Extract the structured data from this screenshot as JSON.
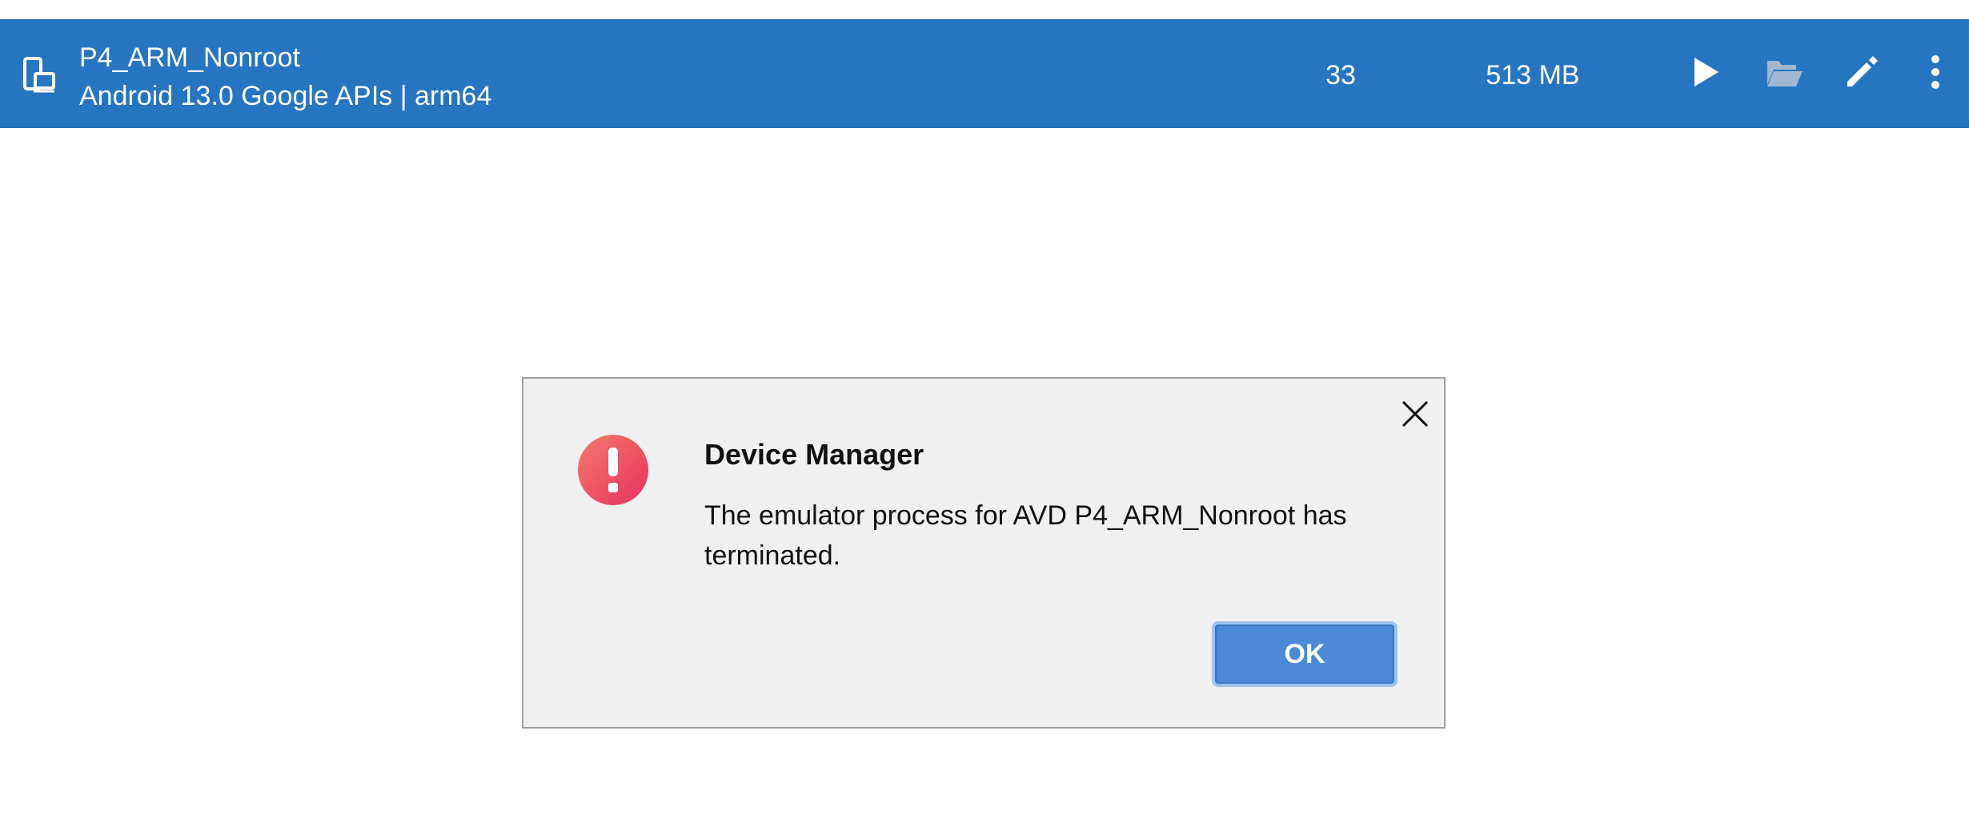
{
  "device": {
    "name": "P4_ARM_Nonroot",
    "subtitle": "Android 13.0 Google APIs | arm64",
    "api_level": "33",
    "size_on_disk": "513 MB",
    "icons": {
      "type": "phone-tablet-icon",
      "run": "play-icon",
      "show_on_disk": "folder-open-icon",
      "edit": "pencil-icon",
      "more": "more-vertical-icon"
    }
  },
  "dialog": {
    "title": "Device Manager",
    "message": "The emulator process for AVD P4_ARM_Nonroot has terminated.",
    "ok_label": "OK",
    "icon": "error-icon",
    "close_icon": "close-icon"
  },
  "colors": {
    "row_background": "#2675c1",
    "dialog_background": "#f0f0f0",
    "ok_button": "#4a8ad6",
    "error_icon": "#ea4264"
  }
}
